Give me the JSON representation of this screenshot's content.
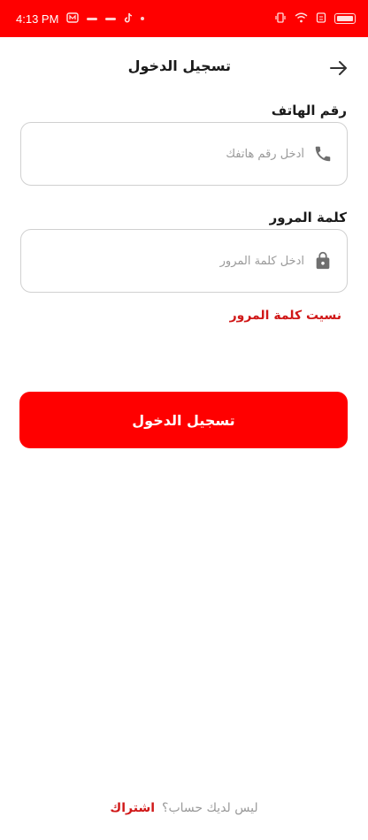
{
  "status_bar": {
    "time": "4:13 PM",
    "background": "#ff0000"
  },
  "header": {
    "title": "تسجيل الدخول",
    "back_icon": "arrow-right-icon"
  },
  "phone": {
    "label": "رقم الهاتف",
    "placeholder": "أدخل رقم هاتفك",
    "icon": "phone-icon"
  },
  "password": {
    "label": "كلمة المرور",
    "placeholder": "ادخل كلمة المرور",
    "icon": "lock-icon"
  },
  "forgot_password": "نسيت كلمة المرور",
  "login_button": "تسجيل الدخول",
  "signup": {
    "question": "ليس لديك حساب؟",
    "link": "اشتراك"
  },
  "colors": {
    "accent": "#ff0000",
    "link": "#d01818",
    "border": "#d0d0d0",
    "placeholder": "#9a9a9a"
  }
}
